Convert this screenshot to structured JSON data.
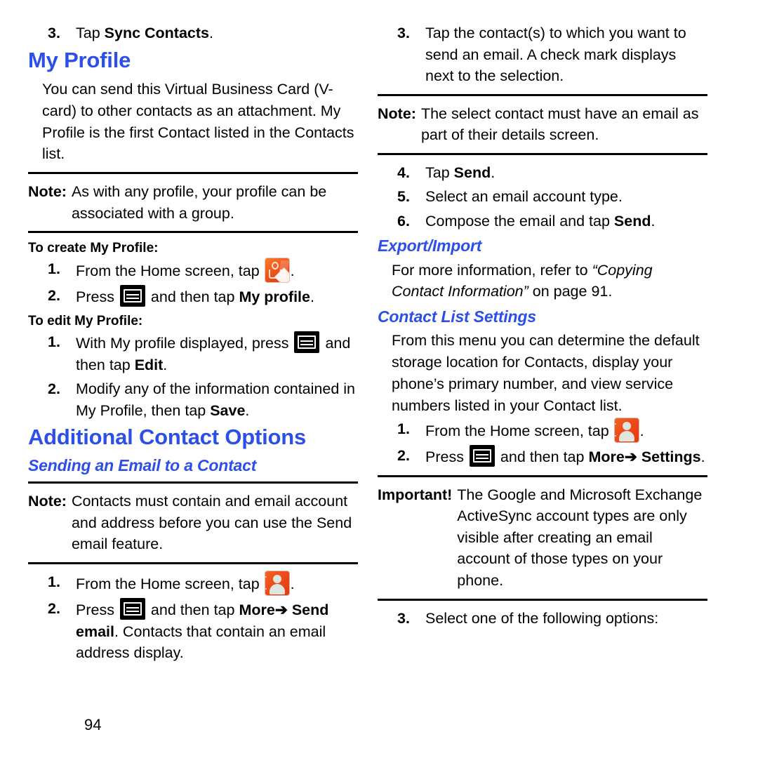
{
  "document": {
    "page_number": "94"
  },
  "left_column": {
    "step_sync": {
      "num": "3.",
      "text_pre": "Tap ",
      "bold": "Sync Contacts",
      "text_post": "."
    },
    "my_profile_heading": "My Profile",
    "my_profile_intro": "You can send this Virtual Business Card (V-card) to other contacts as an attachment. My Profile is the first Contact listed in the Contacts list.",
    "note_group": {
      "label": "Note:",
      "text": "As with any profile, your profile can be associated with a group."
    },
    "to_create_heading": "To create My Profile:",
    "create_step1": {
      "num": "1.",
      "text_pre": "From the Home screen, tap ",
      "icon": "my-profile-app-icon",
      "text_post": "."
    },
    "create_step2": {
      "num": "2.",
      "text_pre": "Press ",
      "icon": "menu-key-icon",
      "text_mid": " and then tap ",
      "bold": "My profile",
      "text_post": "."
    },
    "to_edit_heading": "To edit My Profile:",
    "edit_step1": {
      "num": "1.",
      "text_pre": "With My profile displayed, press ",
      "icon": "menu-key-icon",
      "text_mid": " and then tap ",
      "bold": "Edit",
      "text_post": "."
    },
    "edit_step2": {
      "num": "2.",
      "text_pre": "Modify any of the information contained in My Profile, then tap ",
      "bold": "Save",
      "text_post": "."
    },
    "additional_heading": "Additional Contact Options",
    "sending_email_heading": "Sending an Email to a Contact",
    "note_email": {
      "label": "Note:",
      "text": "Contacts must contain and email account and address before you can use the Send email feature."
    },
    "email_step1": {
      "num": "1.",
      "text_pre": "From the Home screen, tap ",
      "icon": "contacts-app-icon",
      "text_post": "."
    },
    "email_step2": {
      "num": "2.",
      "text_pre": "Press ",
      "icon": "menu-key-icon",
      "text_mid": " and then tap ",
      "bold": "More",
      "arrow": "➔",
      "bold2": "Send email",
      "text_post": ". Contacts that contain an email address display."
    }
  },
  "right_column": {
    "step3_tap_contacts": {
      "num": "3.",
      "text": "Tap the contact(s) to which you want to send an email. A check mark displays next to the selection."
    },
    "note_select_contact": {
      "label": "Note:",
      "text": "The select contact must have an email as part of their details screen."
    },
    "step4": {
      "num": "4.",
      "text_pre": "Tap ",
      "bold": "Send",
      "text_post": "."
    },
    "step5": {
      "num": "5.",
      "text": "Select an email account type."
    },
    "step6": {
      "num": "6.",
      "text_pre": "Compose the email and tap ",
      "bold": "Send",
      "text_post": "."
    },
    "export_import_heading": "Export/Import",
    "export_import_body": {
      "text_pre": "For more information, refer to ",
      "italic_quote": "“Copying Contact Information”",
      "text_post": " on page 91."
    },
    "contact_list_settings_heading": "Contact List Settings",
    "contact_list_body": "From this menu you can determine the default storage location for Contacts, display your phone’s primary number, and view service numbers listed in your Contact list.",
    "cls_step1": {
      "num": "1.",
      "text_pre": "From the Home screen, tap ",
      "icon": "contacts-app-icon",
      "text_post": "."
    },
    "cls_step2": {
      "num": "2.",
      "text_pre": "Press ",
      "icon": "menu-key-icon",
      "text_mid": " and then tap ",
      "bold": "More",
      "arrow": "➔",
      "bold2": "Settings",
      "text_post": "."
    },
    "important_block": {
      "label": "Important!",
      "text": "The Google and Microsoft Exchange ActiveSync account types are only visible after creating an email account of those types on your phone."
    },
    "step3_select_options": {
      "num": "3.",
      "text": "Select one of the following options:"
    }
  },
  "colors": {
    "heading_blue": "#2b4fe8",
    "rule_black": "#000000",
    "icon_orange": "#f0521a"
  }
}
